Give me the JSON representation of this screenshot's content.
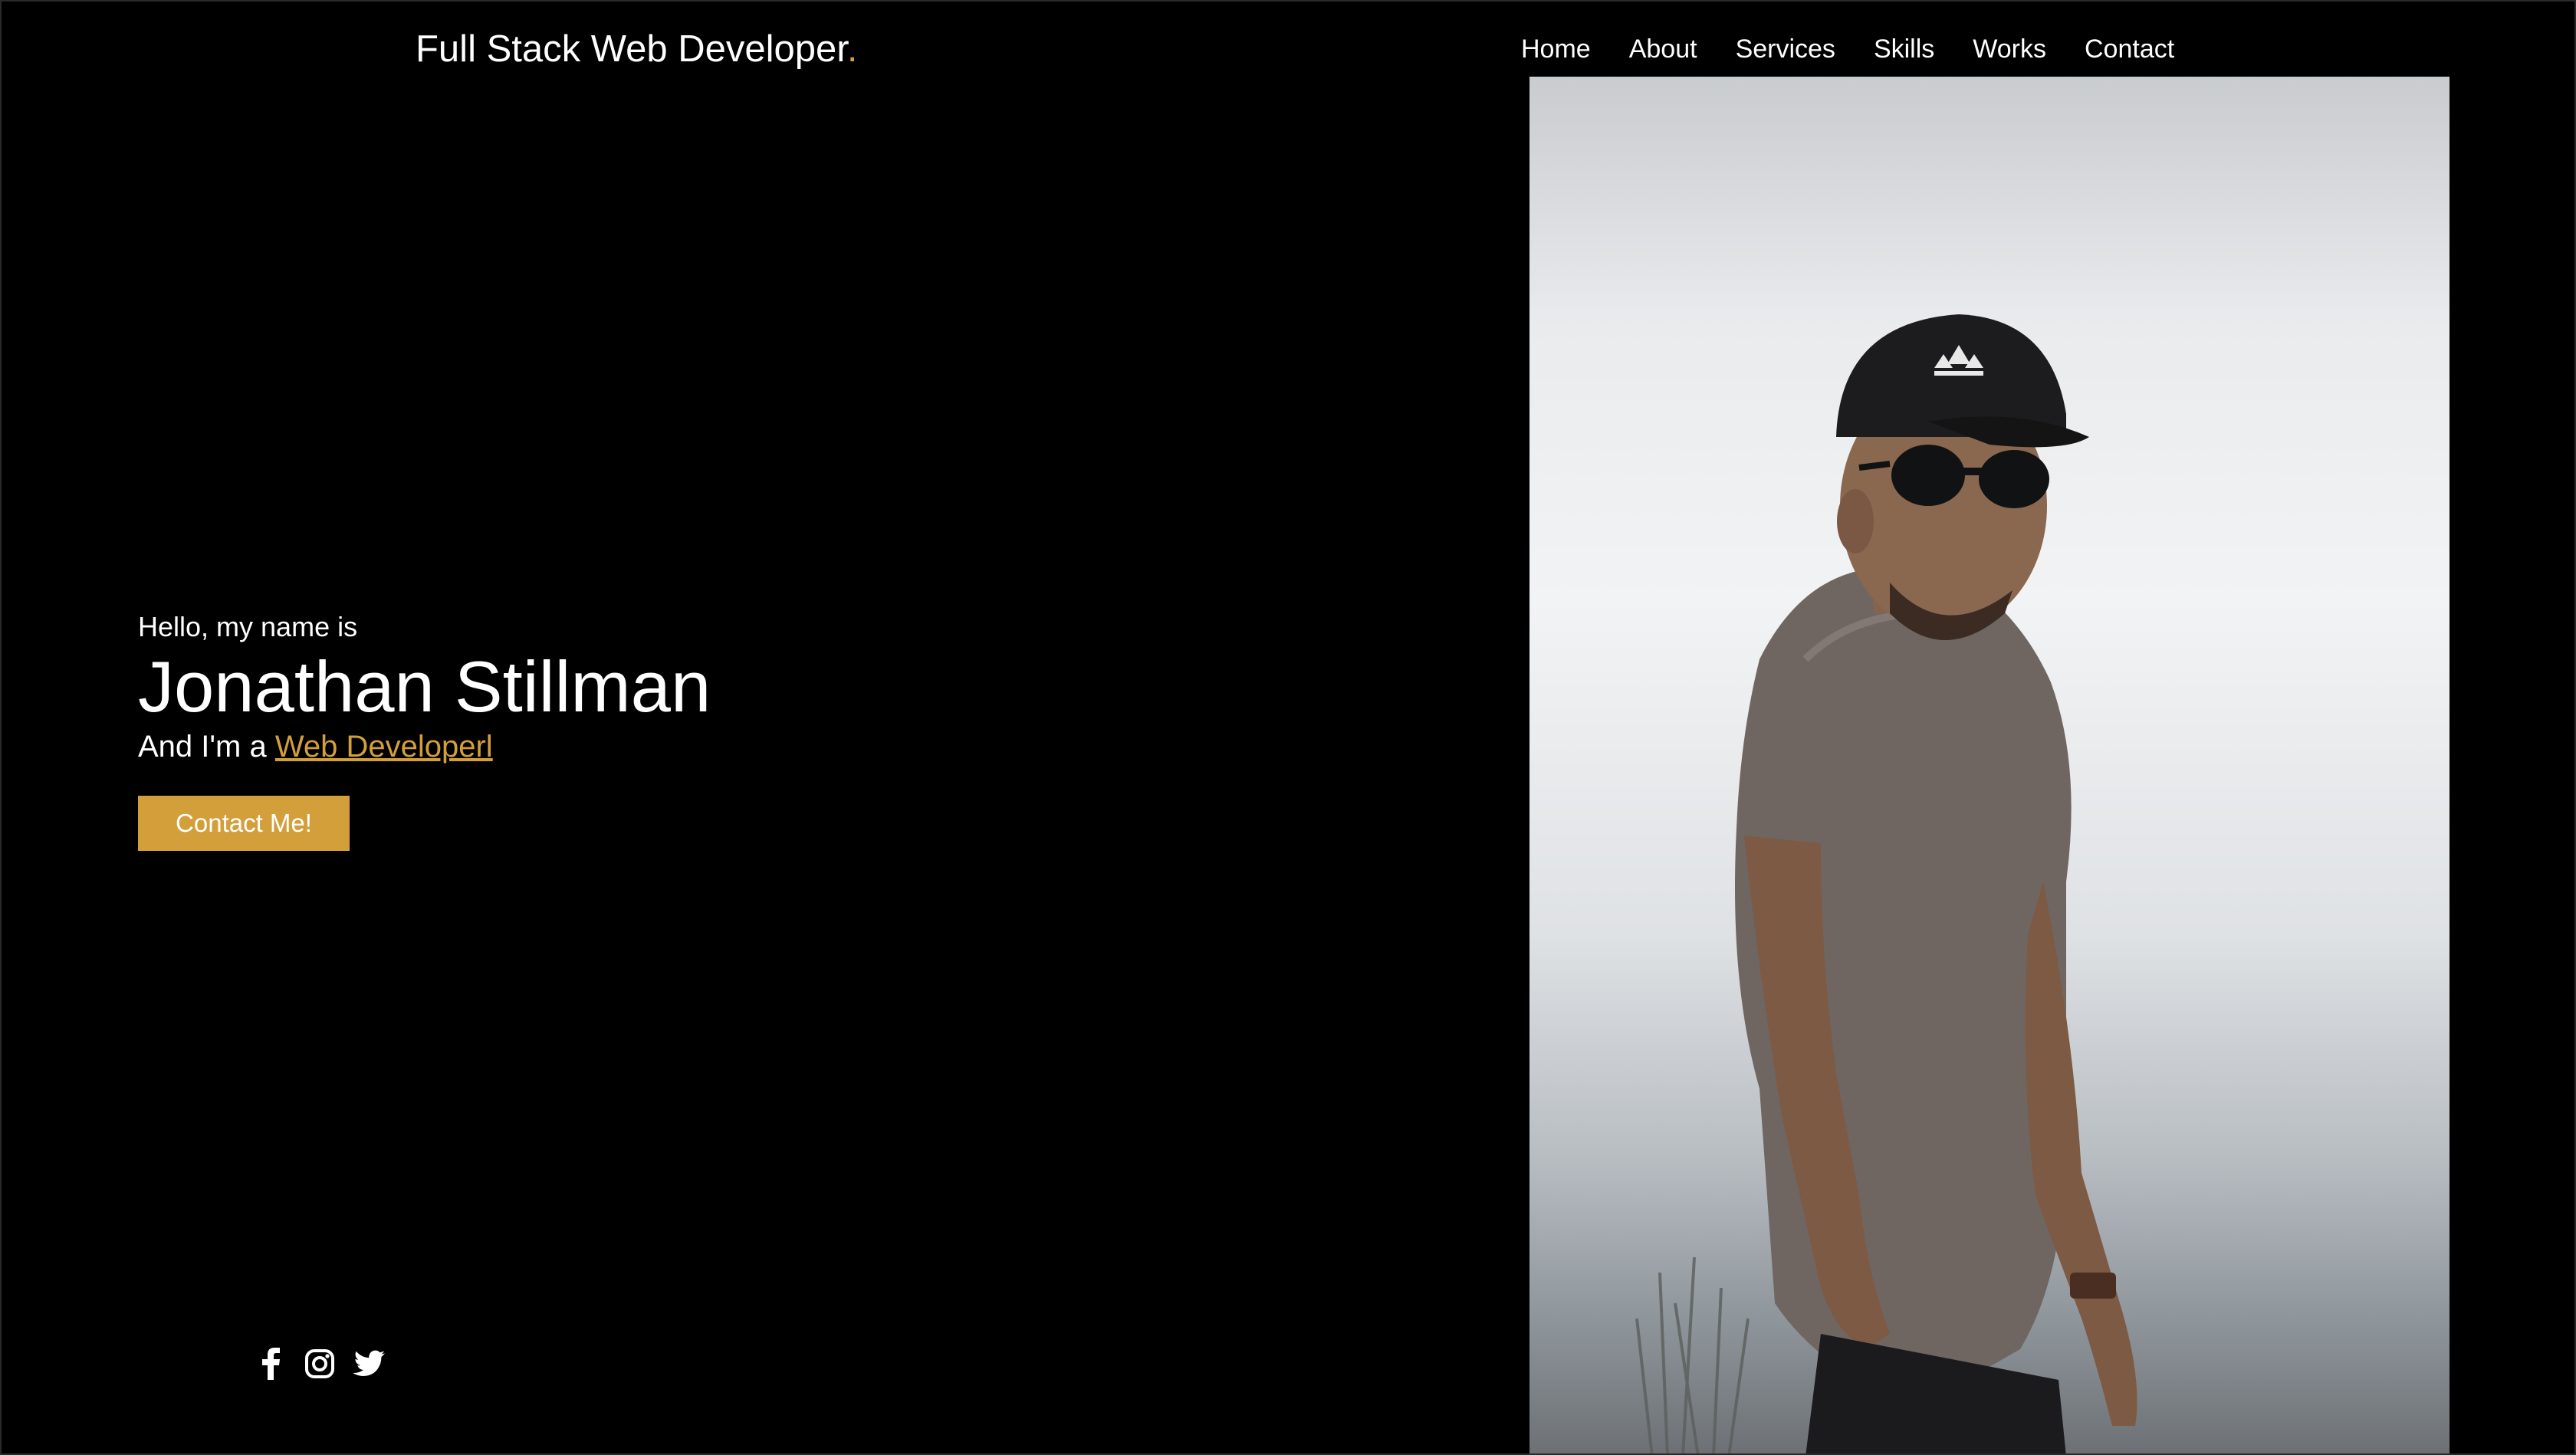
{
  "brand": {
    "text": "Full Stack Web Developer",
    "dot": "."
  },
  "nav": {
    "items": [
      {
        "label": "Home"
      },
      {
        "label": "About"
      },
      {
        "label": "Services"
      },
      {
        "label": "Skills"
      },
      {
        "label": "Works"
      },
      {
        "label": "Contact"
      }
    ]
  },
  "hero": {
    "greeting": "Hello, my name is",
    "name": "Jonathan Stillman",
    "role_prefix": "And I'm a ",
    "role_link": "Web Developerl",
    "cta_label": "Contact Me!"
  },
  "social": {
    "icons": [
      "facebook-icon",
      "instagram-icon",
      "twitter-icon"
    ]
  },
  "colors": {
    "accent": "#d39f3a",
    "background": "#000000",
    "text": "#ffffff"
  }
}
